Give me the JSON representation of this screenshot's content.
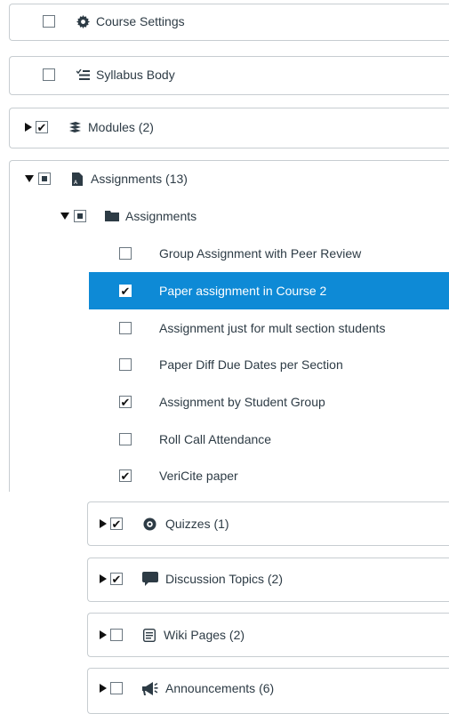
{
  "items": {
    "course_settings": {
      "label": "Course Settings",
      "checked": false,
      "icon": "gear-icon"
    },
    "syllabus_body": {
      "label": "Syllabus Body",
      "checked": false,
      "icon": "list-icon"
    },
    "modules": {
      "label": "Modules (2)",
      "checked": true,
      "icon": "stack-icon"
    },
    "assignments": {
      "label": "Assignments (13)",
      "state": "mixed",
      "icon": "document-icon"
    },
    "assignments_group": {
      "label": "Assignments",
      "state": "mixed",
      "icon": "folder-icon"
    },
    "assignment_list": [
      {
        "label": "Group Assignment with Peer Review",
        "checked": false
      },
      {
        "label": "Paper assignment in Course 2",
        "checked": true,
        "selected": true
      },
      {
        "label": "Assignment just for mult section students",
        "checked": false
      },
      {
        "label": "Paper Diff Due Dates per Section",
        "checked": false
      },
      {
        "label": "Assignment by Student Group",
        "checked": true
      },
      {
        "label": "Roll Call Attendance",
        "checked": false
      },
      {
        "label": "VeriCite paper",
        "checked": true
      }
    ],
    "quizzes": {
      "label": "Quizzes (1)",
      "checked": true,
      "icon": "quiz-icon"
    },
    "discussion_topics": {
      "label": "Discussion Topics (2)",
      "checked": true,
      "icon": "speech-bubble-icon"
    },
    "wiki_pages": {
      "label": "Wiki Pages (2)",
      "checked": false,
      "icon": "pages-icon"
    },
    "announcements": {
      "label": "Announcements (6)",
      "checked": false,
      "icon": "megaphone-icon"
    }
  },
  "colors": {
    "selection": "#0e8ad6",
    "border": "#c7cdd1",
    "text": "#2d3b45"
  }
}
